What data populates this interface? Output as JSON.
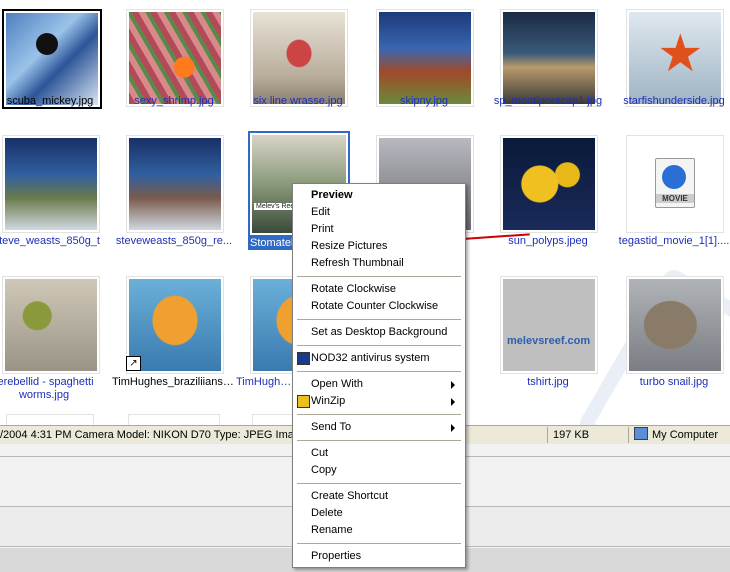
{
  "files": [
    {
      "name": "scuba_mickey.jpg",
      "color": "#000",
      "selected": false
    },
    {
      "name": "sexy_shrimp.jpg",
      "color": "blue",
      "selected": false
    },
    {
      "name": "six line wrasse.jpg",
      "color": "blue",
      "selected": false
    },
    {
      "name": "skipny.jpg",
      "color": "blue",
      "selected": false
    },
    {
      "name": "sp_montiporacap1.jpg",
      "color": "blue",
      "selected": false
    },
    {
      "name": "starfishunderside.jpg",
      "color": "blue",
      "selected": false
    },
    {
      "name": "steve_weasts_850g_t...",
      "color": "blue",
      "selected": false
    },
    {
      "name": "steveweasts_850g_re...",
      "color": "blue",
      "selected": false
    },
    {
      "name": "Stomatell",
      "color": "white",
      "selected": true
    },
    {
      "name": "",
      "color": "blue",
      "selected": false
    },
    {
      "name": "sun_polyps.jpeg",
      "color": "blue",
      "selected": false
    },
    {
      "name": "tegastid_movie_1[1]....",
      "color": "blue",
      "selected": false
    },
    {
      "name": "terebellid - spaghetti worms.jpg",
      "color": "blue",
      "selected": false
    },
    {
      "name": "TimHughes_braziliianse...",
      "color": "#000",
      "selected": false
    },
    {
      "name": "TimHughes_",
      "color": "blue",
      "selected": false
    },
    {
      "name": "",
      "color": "blue",
      "selected": false
    },
    {
      "name": "tshirt.jpg",
      "color": "blue",
      "selected": false
    },
    {
      "name": "turbo snail.jpg",
      "color": "blue",
      "selected": false
    }
  ],
  "movie_label": "MOVIE",
  "tshirt_text": "melevsreef.com",
  "thumb_logo_text": "Melev's Reef",
  "status": {
    "details": "/2004 4:31 PM Camera Model: NIKON D70 Type: JPEG Image",
    "size": "197 KB",
    "location": "My Computer"
  },
  "context_menu": {
    "items": [
      {
        "label": "Preview",
        "bold": true
      },
      {
        "label": "Edit"
      },
      {
        "label": "Print"
      },
      {
        "label": "Resize Pictures"
      },
      {
        "label": "Refresh Thumbnail"
      },
      {
        "sep": true
      },
      {
        "label": "Rotate Clockwise"
      },
      {
        "label": "Rotate Counter Clockwise"
      },
      {
        "sep": true
      },
      {
        "label": "Set as Desktop Background"
      },
      {
        "sep": true
      },
      {
        "label": "NOD32 antivirus system",
        "icon": "nod32-icon"
      },
      {
        "sep": true
      },
      {
        "label": "Open With",
        "submenu": true
      },
      {
        "label": "WinZip",
        "submenu": true,
        "icon": "winzip-icon"
      },
      {
        "sep": true
      },
      {
        "label": "Send To",
        "submenu": true
      },
      {
        "sep": true
      },
      {
        "label": "Cut"
      },
      {
        "label": "Copy"
      },
      {
        "sep": true
      },
      {
        "label": "Create Shortcut"
      },
      {
        "label": "Delete"
      },
      {
        "label": "Rename"
      },
      {
        "sep": true
      },
      {
        "label": "Properties"
      }
    ]
  },
  "colors": {
    "selection": "#316ac5",
    "link_text": "#1c2fb8",
    "callout_arrow": "#cc0000",
    "statusbar": "#ece9d8"
  }
}
